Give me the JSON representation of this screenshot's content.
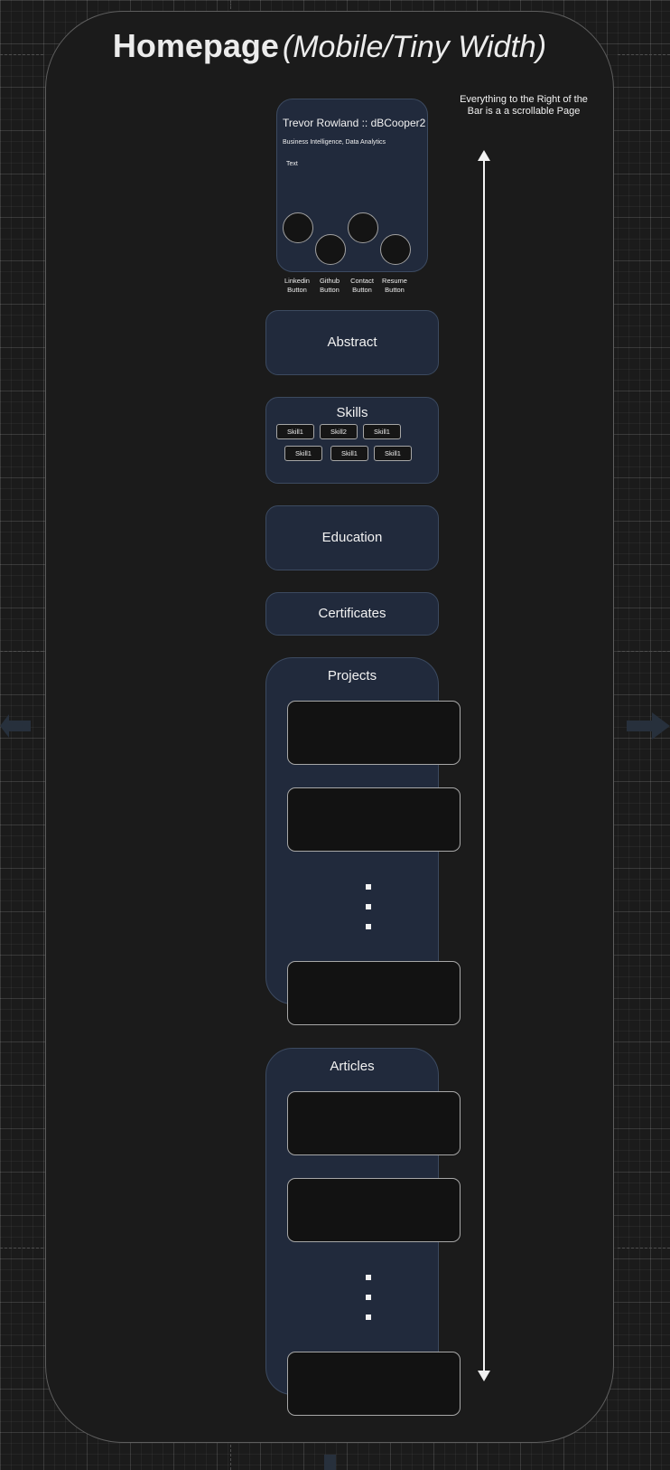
{
  "title": {
    "main": "Homepage",
    "sub": "(Mobile/Tiny Width)"
  },
  "note": "Everything to the Right of the Bar is a a scrollable Page",
  "profile": {
    "name": "Trevor Rowland :: dBCooper2",
    "subtitle": "Business Intelligence, Data Analytics",
    "text": "Text",
    "buttons": [
      {
        "line1": "Linkedin",
        "line2": "Button"
      },
      {
        "line1": "Github",
        "line2": "Button"
      },
      {
        "line1": "Contact",
        "line2": "Button"
      },
      {
        "line1": "Resume",
        "line2": "Button"
      }
    ]
  },
  "sections": {
    "abstract": "Abstract",
    "skills": "Skills",
    "education": "Education",
    "certificates": "Certificates",
    "projects": "Projects",
    "articles": "Articles"
  },
  "skills": [
    "Skill1",
    "Skill2",
    "Skill1",
    "Skill1",
    "Skill1",
    "Skill1"
  ],
  "colors": {
    "background": "#1b1b1b",
    "card": "#212a3c",
    "card_border": "#3c4a60",
    "item_box": "#121212",
    "arrow": "#f2f2f2"
  }
}
